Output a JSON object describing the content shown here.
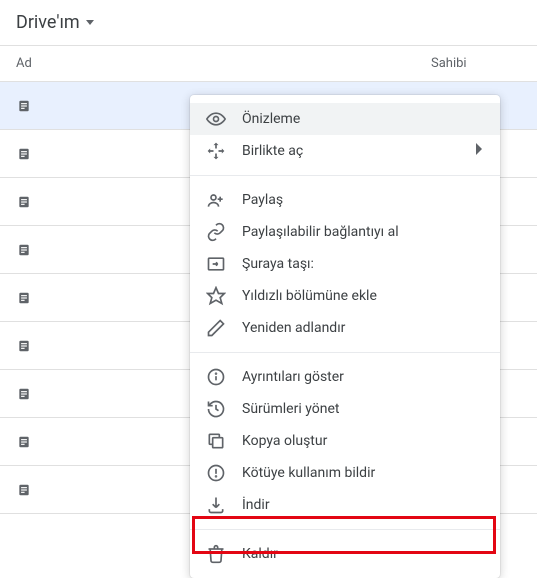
{
  "breadcrumb": {
    "label": "Drive'ım"
  },
  "columns": {
    "name": "Ad",
    "owner": "Sahibi"
  },
  "menu": {
    "preview": "Önizleme",
    "open_with": "Birlikte aç",
    "share": "Paylaş",
    "get_link": "Paylaşılabilir bağlantıyı al",
    "move_to": "Şuraya taşı:",
    "add_star": "Yıldızlı bölümüne ekle",
    "rename": "Yeniden adlandır",
    "details": "Ayrıntıları göster",
    "versions": "Sürümleri yönet",
    "copy": "Kopya oluştur",
    "report": "Kötüye kullanım bildir",
    "download": "İndir",
    "remove": "Kaldır"
  }
}
